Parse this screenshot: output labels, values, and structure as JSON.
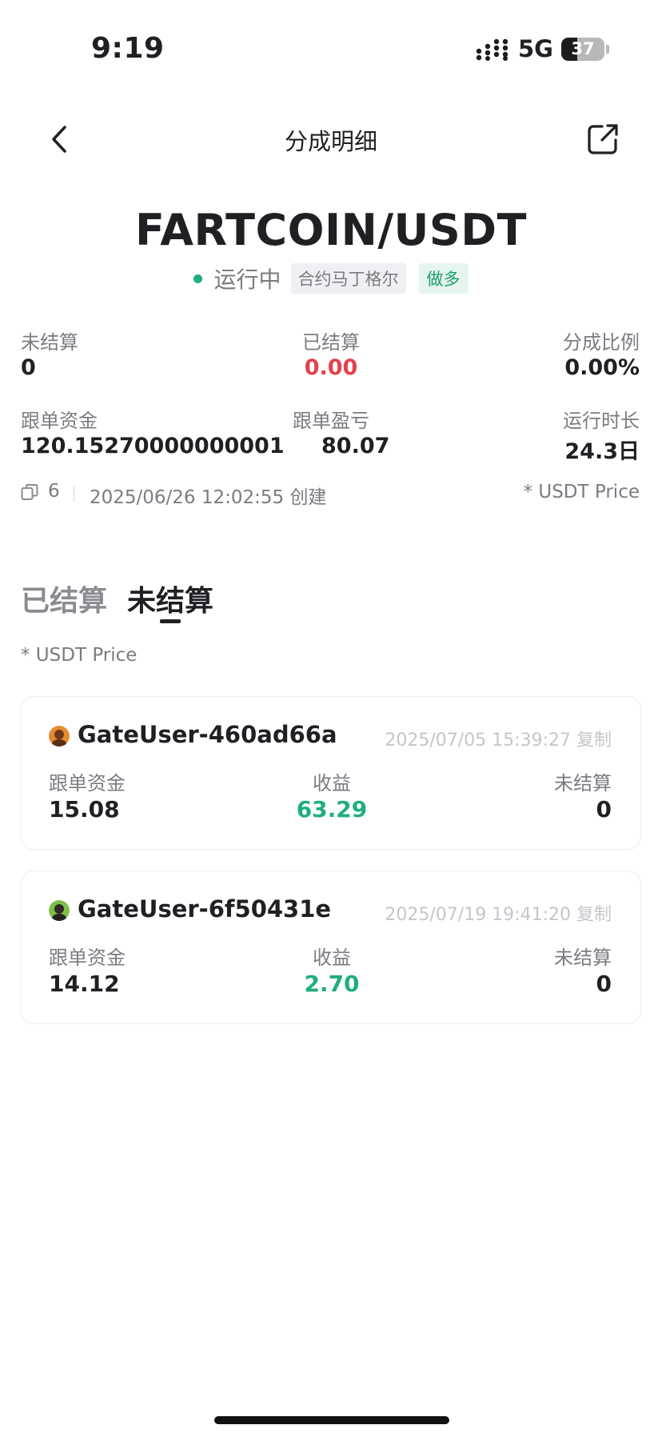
{
  "status_bar": {
    "time": "9:19",
    "network": "5G",
    "battery": "37",
    "battery_level": 0.37
  },
  "nav": {
    "title": "分成明细"
  },
  "header": {
    "pair": "FARTCOIN/USDT",
    "status": "运行中",
    "strategy_tag": "合约马丁格尔",
    "direction_tag": "做多"
  },
  "stats": {
    "unsettled": {
      "label": "未结算",
      "value": "0"
    },
    "settled": {
      "label": "已结算",
      "value": "0.00"
    },
    "share_ratio": {
      "label": "分成比例",
      "value": "0.00%"
    },
    "follow_funds": {
      "label": "跟单资金",
      "value": "120.15270000000001"
    },
    "follow_pnl": {
      "label": "跟单盈亏",
      "value": "80.07"
    },
    "run_time": {
      "label": "运行时长",
      "value": "24.3日"
    }
  },
  "meta": {
    "copy_count": "6",
    "created": "2025/06/26 12:02:55 创建",
    "price_note": "* USDT Price"
  },
  "tabs": [
    {
      "label": "已结算",
      "active": false
    },
    {
      "label": "未结算",
      "active": true
    }
  ],
  "list_note": "* USDT Price",
  "records": [
    {
      "user": "GateUser-460ad66a",
      "time_copy": "2025/07/05 15:39:27 复制",
      "funds_label": "跟单资金",
      "funds": "15.08",
      "profit_label": "收益",
      "profit": "63.29",
      "unsettled_label": "未结算",
      "unsettled": "0",
      "avatar_icon": "avatar-orange-icon"
    },
    {
      "user": "GateUser-6f50431e",
      "time_copy": "2025/07/19 19:41:20 复制",
      "funds_label": "跟单资金",
      "funds": "14.12",
      "profit_label": "收益",
      "profit": "2.70",
      "unsettled_label": "未结算",
      "unsettled": "0",
      "avatar_icon": "avatar-green-icon"
    }
  ],
  "colors": {
    "accent_green": "#1fae7e",
    "loss_red": "#e4414e",
    "muted_text": "#7a7c82"
  }
}
